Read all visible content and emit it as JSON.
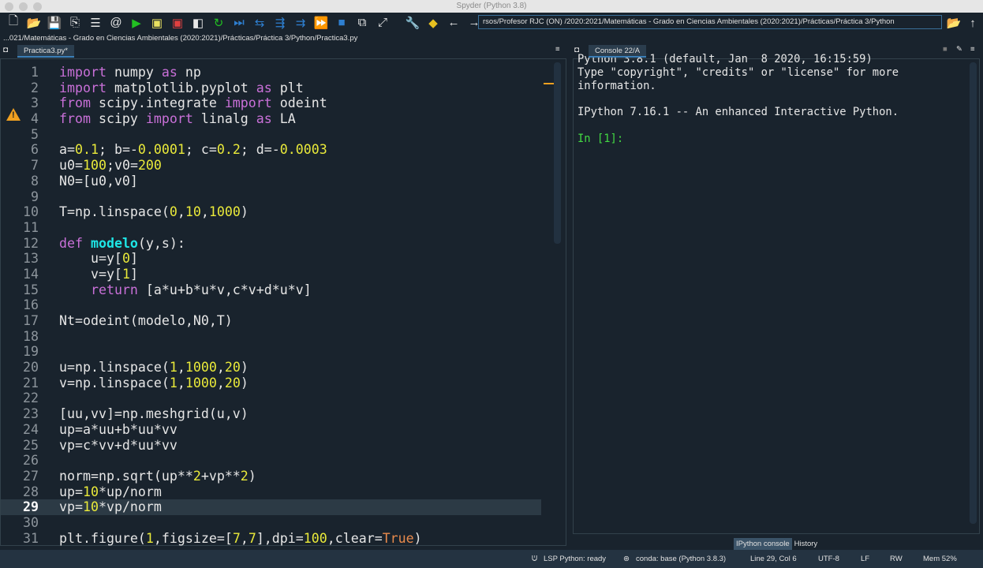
{
  "window": {
    "title": "Spyder (Python 3.8)"
  },
  "toolbar": {
    "icons": [
      "new-file-icon",
      "open-folder-icon",
      "save-icon",
      "save-all-icon",
      "list-icon",
      "at-icon",
      "run-icon",
      "run-cell-icon",
      "run-cell-advance-icon",
      "run-selection-icon",
      "rerun-icon",
      "debug-step-icon",
      "debug-continue-icon",
      "debug-stepin-icon",
      "debug-return-icon",
      "debug-skip-icon",
      "stop-icon",
      "maximize-pane-icon",
      "fullscreen-icon",
      "wrench-icon",
      "python-icon",
      "back-arrow-icon",
      "forward-arrow-icon"
    ],
    "working_dir": "rsos/Profesor RJC (ON) /2020:2021/Matemáticas - Grado en Ciencias Ambientales (2020:2021)/Prácticas/Práctica 3/Python"
  },
  "editor": {
    "file_path": "...021/Matemáticas - Grado en Ciencias Ambientales (2020:2021)/Prácticas/Práctica 3/Python/Practica3.py",
    "tab": "Practica3.py*",
    "current_line": 29,
    "warning_line": 4,
    "lines": [
      [
        [
          "k",
          "import"
        ],
        [
          "t",
          " numpy "
        ],
        [
          "k",
          "as"
        ],
        [
          "t",
          " np"
        ]
      ],
      [
        [
          "k",
          "import"
        ],
        [
          "t",
          " matplotlib.pyplot "
        ],
        [
          "k",
          "as"
        ],
        [
          "t",
          " plt"
        ]
      ],
      [
        [
          "k",
          "from"
        ],
        [
          "t",
          " scipy.integrate "
        ],
        [
          "k",
          "import"
        ],
        [
          "t",
          " odeint"
        ]
      ],
      [
        [
          "k",
          "from"
        ],
        [
          "t",
          " scipy "
        ],
        [
          "k",
          "import"
        ],
        [
          "t",
          " linalg "
        ],
        [
          "k",
          "as"
        ],
        [
          "t",
          " LA"
        ]
      ],
      [],
      [
        [
          "t",
          "a="
        ],
        [
          "n",
          "0.1"
        ],
        [
          "t",
          "; b=-"
        ],
        [
          "n",
          "0.0001"
        ],
        [
          "t",
          "; c="
        ],
        [
          "n",
          "0.2"
        ],
        [
          "t",
          "; d=-"
        ],
        [
          "n",
          "0.0003"
        ]
      ],
      [
        [
          "t",
          "u0="
        ],
        [
          "n",
          "100"
        ],
        [
          "t",
          ";v0="
        ],
        [
          "n",
          "200"
        ]
      ],
      [
        [
          "t",
          "N0=[u0,v0]"
        ]
      ],
      [],
      [
        [
          "t",
          "T=np.linspace("
        ],
        [
          "n",
          "0"
        ],
        [
          "t",
          ","
        ],
        [
          "n",
          "10"
        ],
        [
          "t",
          ","
        ],
        [
          "n",
          "1000"
        ],
        [
          "t",
          ")"
        ]
      ],
      [],
      [
        [
          "k",
          "def"
        ],
        [
          "t",
          " "
        ],
        [
          "f",
          "modelo"
        ],
        [
          "t",
          "(y,s):"
        ]
      ],
      [
        [
          "t",
          "    u=y["
        ],
        [
          "n",
          "0"
        ],
        [
          "t",
          "]"
        ]
      ],
      [
        [
          "t",
          "    v=y["
        ],
        [
          "n",
          "1"
        ],
        [
          "t",
          "]"
        ]
      ],
      [
        [
          "t",
          "    "
        ],
        [
          "k",
          "return"
        ],
        [
          "t",
          " [a*u+b*u*v,c*v+d*u*v]"
        ]
      ],
      [],
      [
        [
          "t",
          "Nt=odeint(modelo,N0,T)"
        ]
      ],
      [],
      [],
      [
        [
          "t",
          "u=np.linspace("
        ],
        [
          "n",
          "1"
        ],
        [
          "t",
          ","
        ],
        [
          "n",
          "1000"
        ],
        [
          "t",
          ","
        ],
        [
          "n",
          "20"
        ],
        [
          "t",
          ")"
        ]
      ],
      [
        [
          "t",
          "v=np.linspace("
        ],
        [
          "n",
          "1"
        ],
        [
          "t",
          ","
        ],
        [
          "n",
          "1000"
        ],
        [
          "t",
          ","
        ],
        [
          "n",
          "20"
        ],
        [
          "t",
          ")"
        ]
      ],
      [],
      [
        [
          "t",
          "[uu,vv]=np.meshgrid(u,v)"
        ]
      ],
      [
        [
          "t",
          "up=a*uu+b*uu*vv"
        ]
      ],
      [
        [
          "t",
          "vp=c*vv+d*uu*vv"
        ]
      ],
      [],
      [
        [
          "t",
          "norm=np.sqrt(up**"
        ],
        [
          "n",
          "2"
        ],
        [
          "t",
          "+vp**"
        ],
        [
          "n",
          "2"
        ],
        [
          "t",
          ")"
        ]
      ],
      [
        [
          "t",
          "up="
        ],
        [
          "n",
          "10"
        ],
        [
          "t",
          "*up/norm"
        ]
      ],
      [
        [
          "t",
          "vp="
        ],
        [
          "n",
          "10"
        ],
        [
          "t",
          "*vp/norm"
        ]
      ],
      [],
      [
        [
          "t",
          "plt.figure("
        ],
        [
          "n",
          "1"
        ],
        [
          "t",
          ",figsize=["
        ],
        [
          "n",
          "7"
        ],
        [
          "t",
          ","
        ],
        [
          "n",
          "7"
        ],
        [
          "t",
          "],dpi="
        ],
        [
          "n",
          "100"
        ],
        [
          "t",
          ",clear="
        ],
        [
          "c",
          "True"
        ],
        [
          "t",
          ")"
        ]
      ]
    ]
  },
  "console": {
    "tab": "Console 22/A",
    "lines": [
      "Python 3.8.1 (default, Jan  8 2020, 16:15:59)",
      "Type \"copyright\", \"credits\" or \"license\" for more",
      "information.",
      "",
      "IPython 7.16.1 -- An enhanced Interactive Python.",
      ""
    ],
    "prompt": "In [1]:",
    "bottom_tabs": [
      "IPython console",
      "History"
    ]
  },
  "status": {
    "lsp": "LSP Python: ready",
    "conda": "conda: base (Python 3.8.3)",
    "position": "Line 29, Col 6",
    "encoding": "UTF-8",
    "eol": "LF",
    "mode": "RW",
    "memory": "Mem 52%"
  },
  "colors": {
    "background": "#19232d",
    "keyword": "#c970d8",
    "number": "#eaea3a",
    "function": "#1ee6e6",
    "constant": "#e88a4c",
    "prompt": "#43d943",
    "accent": "#3b7fb8"
  }
}
